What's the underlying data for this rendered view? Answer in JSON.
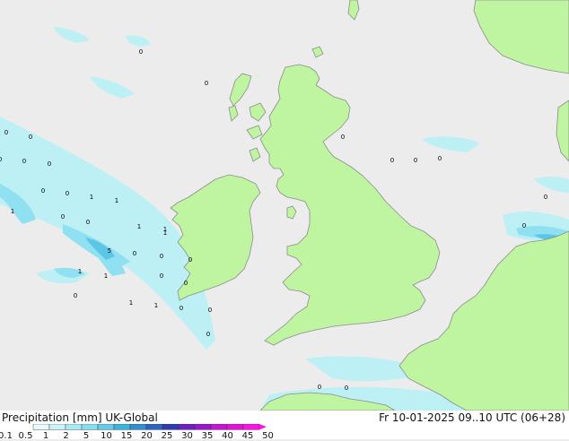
{
  "map": {
    "colors": {
      "sea": "#ececec",
      "land": "#bff5a0",
      "coast": "#8c8c8c",
      "precip_light": "#bdf0f5",
      "precip_mid": "#8fe0f0",
      "precip_strong": "#5cc6e6"
    },
    "point_values": [
      {
        "label": "0"
      },
      {
        "label": "0"
      },
      {
        "label": "0"
      },
      {
        "label": "0"
      },
      {
        "label": "0"
      },
      {
        "label": "0"
      },
      {
        "label": "0"
      },
      {
        "label": "0"
      },
      {
        "label": "0"
      },
      {
        "label": "1"
      },
      {
        "label": "1"
      },
      {
        "label": "1"
      },
      {
        "label": "0"
      },
      {
        "label": "1"
      },
      {
        "label": "0"
      },
      {
        "label": "1"
      },
      {
        "label": "1"
      },
      {
        "label": "5"
      },
      {
        "label": "0"
      },
      {
        "label": "0"
      },
      {
        "label": "1"
      },
      {
        "label": "0"
      },
      {
        "label": "1"
      },
      {
        "label": "0"
      },
      {
        "label": "0"
      },
      {
        "label": "0"
      },
      {
        "label": "1"
      },
      {
        "label": "1"
      },
      {
        "label": "0"
      },
      {
        "label": "0"
      },
      {
        "label": "0"
      },
      {
        "label": "0"
      },
      {
        "label": "0"
      },
      {
        "label": "0"
      },
      {
        "label": "0"
      },
      {
        "label": "0"
      },
      {
        "label": "0"
      },
      {
        "label": "0"
      },
      {
        "label": "0"
      }
    ]
  },
  "footer": {
    "title": "Precipitation [mm]  UK-Global",
    "datetime": "Fr 10-01-2025 09..10 UTC (06+28)",
    "scale_labels": [
      "0.1",
      "0.5",
      "1",
      "2",
      "5",
      "10",
      "15",
      "20",
      "25",
      "30",
      "35",
      "40",
      "45",
      "50"
    ],
    "scale_colors": [
      "#e6fbfc",
      "#c8f3f8",
      "#a8eaf4",
      "#86deef",
      "#62cde8",
      "#3ab4dc",
      "#2f8fd0",
      "#2c64c4",
      "#2c3cb8",
      "#6a1fc8",
      "#9a16d0",
      "#c812d6",
      "#e60fdc",
      "#ff10e6"
    ]
  }
}
